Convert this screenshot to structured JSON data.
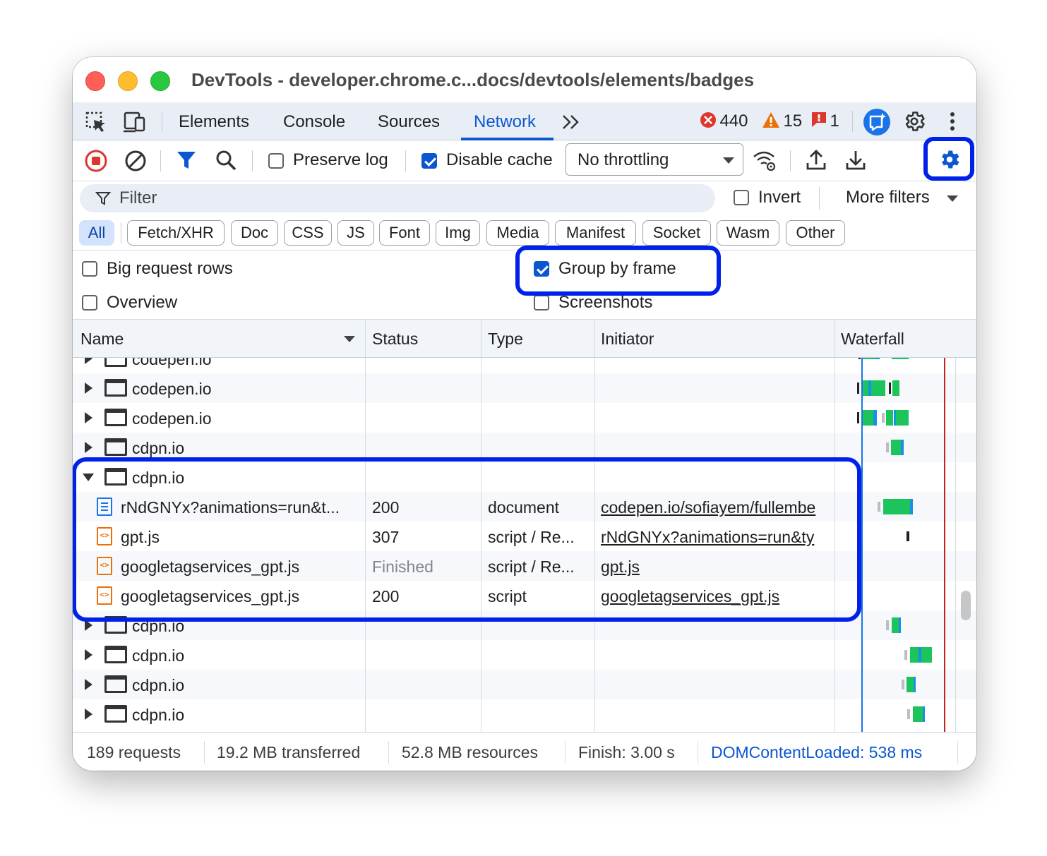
{
  "window": {
    "title": "DevTools - developer.chrome.c...docs/devtools/elements/badges"
  },
  "tabs": [
    {
      "label": "Elements"
    },
    {
      "label": "Console"
    },
    {
      "label": "Sources"
    },
    {
      "label": "Network"
    }
  ],
  "issues": {
    "errors": "440",
    "warnings": "15",
    "info": "1"
  },
  "toolbar": {
    "preserve_log": "Preserve log",
    "preserve_log_checked": false,
    "disable_cache": "Disable cache",
    "disable_cache_checked": true,
    "throttling": "No throttling"
  },
  "filter": {
    "placeholder": "Filter",
    "invert": "Invert",
    "more_filters": "More filters"
  },
  "type_filters": [
    "All",
    "Fetch/XHR",
    "Doc",
    "CSS",
    "JS",
    "Font",
    "Img",
    "Media",
    "Manifest",
    "Socket",
    "Wasm",
    "Other"
  ],
  "settings": {
    "big_request_rows": "Big request rows",
    "group_by_frame": "Group by frame",
    "group_by_frame_checked": true,
    "overview": "Overview",
    "screenshots": "Screenshots"
  },
  "columns": {
    "name": "Name",
    "status": "Status",
    "type": "Type",
    "initiator": "Initiator",
    "waterfall": "Waterfall"
  },
  "rows": [
    {
      "kind": "frame",
      "expanded": false,
      "name": "codepen.io"
    },
    {
      "kind": "frame",
      "expanded": false,
      "name": "codepen.io"
    },
    {
      "kind": "frame",
      "expanded": false,
      "name": "codepen.io"
    },
    {
      "kind": "frame",
      "expanded": false,
      "name": "cdpn.io"
    },
    {
      "kind": "frame",
      "expanded": true,
      "name": "cdpn.io"
    },
    {
      "kind": "doc",
      "name": "rNdGNYx?animations=run&t...",
      "status": "200",
      "type": "document",
      "initiator": "codepen.io/sofiayem/fullembe"
    },
    {
      "kind": "script",
      "name": "gpt.js",
      "status": "307",
      "type": "script / Re...",
      "initiator": "rNdGNYx?animations=run&ty"
    },
    {
      "kind": "script",
      "name": "googletagservices_gpt.js",
      "status": "Finished",
      "type": "script / Re...",
      "initiator": "gpt.js"
    },
    {
      "kind": "script",
      "name": "googletagservices_gpt.js",
      "status": "200",
      "type": "script",
      "initiator": "googletagservices_gpt.js"
    },
    {
      "kind": "frame",
      "expanded": false,
      "name": "cdpn.io"
    },
    {
      "kind": "frame",
      "expanded": false,
      "name": "cdpn.io"
    },
    {
      "kind": "frame",
      "expanded": false,
      "name": "cdpn.io"
    },
    {
      "kind": "frame",
      "expanded": false,
      "name": "cdpn.io"
    }
  ],
  "status_bar": {
    "requests": "189 requests",
    "transferred": "19.2 MB transferred",
    "resources": "52.8 MB resources",
    "finish": "Finish: 3.00 s",
    "dom_content_loaded": "DOMContentLoaded: 538 ms"
  },
  "colors": {
    "accent": "#0b57d0",
    "highlight": "#0022e8",
    "waterfall_green": "#1cc45c",
    "waterfall_blue": "#1a8fe8",
    "dcl_line": "#1a73e8",
    "load_line": "#c5221f"
  }
}
